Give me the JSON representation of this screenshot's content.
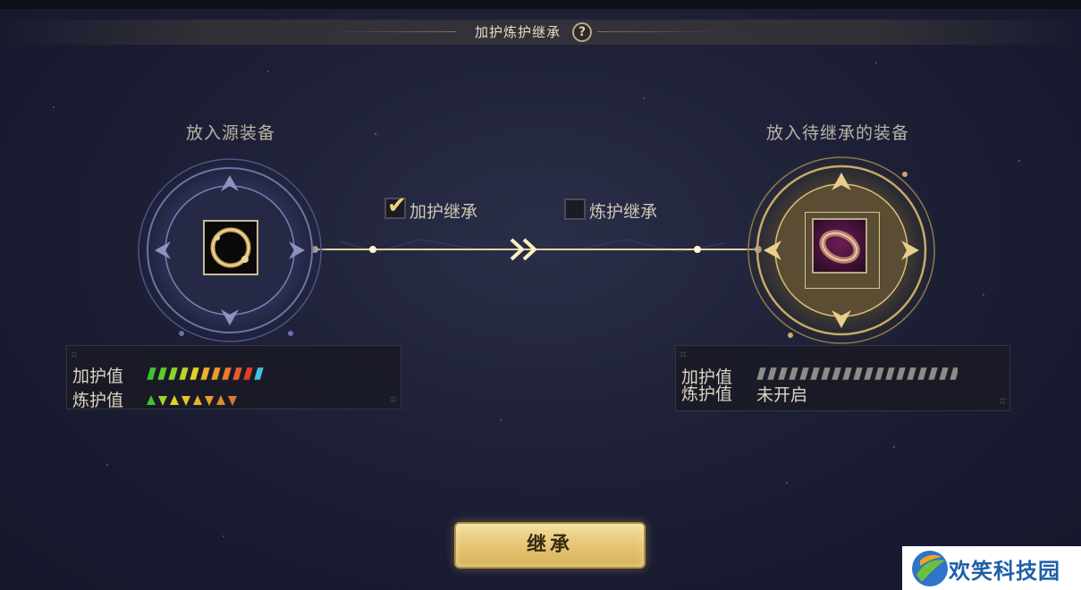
{
  "title": "加护炼护继承",
  "help_symbol": "?",
  "source_slot": {
    "label": "放入源装备"
  },
  "target_slot": {
    "label": "放入待继承的装备"
  },
  "options": [
    {
      "label": "加护继承",
      "checked": true
    },
    {
      "label": "炼护继承",
      "checked": false
    }
  ],
  "source_stats": {
    "jiahu_label": "加护值",
    "lianhu_label": "炼护值",
    "jiahu_level": 11,
    "jiahu_max": 11,
    "lianhu_level": 8
  },
  "target_stats": {
    "jiahu_label": "加护值",
    "lianhu_label": "炼护值",
    "lianhu_value": "未开启",
    "jiahu_level": 0,
    "jiahu_max": 19
  },
  "button": {
    "label": "继承"
  },
  "watermark": {
    "text": "欢笑科技园"
  },
  "colors": {
    "accent_gold": "#e7c878",
    "title_text": "#e9dcbf"
  }
}
